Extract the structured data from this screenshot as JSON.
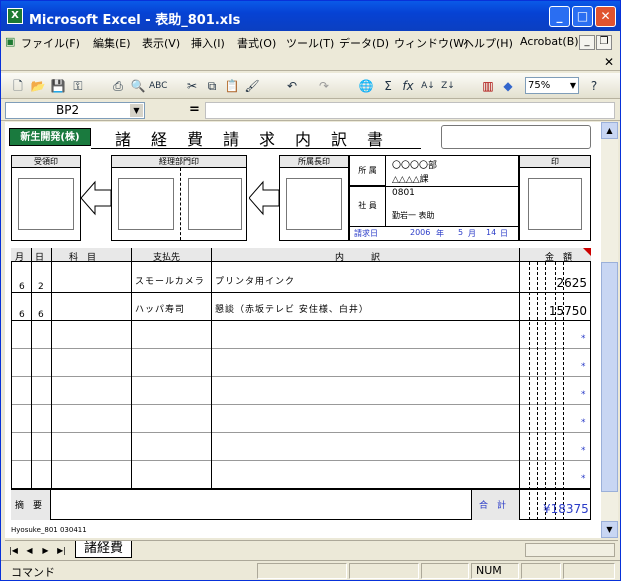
{
  "window": {
    "title": "Microsoft Excel - 表助_801.xls",
    "title_icon": "X"
  },
  "menu": [
    "ファイル(F)",
    "編集(E)",
    "表示(V)",
    "挿入(I)",
    "書式(O)",
    "ツール(T)",
    "データ(D)",
    "ウィンドウ(W)",
    "ヘルプ(H)",
    "Acrobat(B)"
  ],
  "toolbar": {
    "zoom": "75%"
  },
  "formula": {
    "namebox": "BP2",
    "eq": "="
  },
  "form": {
    "company": "新生開発(株)",
    "title": "諸　経　費　請　求　内　訳　書",
    "stamps": {
      "receipt": "受領印",
      "accounting": "経理部門印",
      "dept_head": "所属長印",
      "seal": "印"
    },
    "dept_label": "所 属",
    "dept1": "〇〇〇〇部",
    "dept2": "△△△△課",
    "emp_label": "社 員",
    "emp_no": "0801",
    "emp_name": "勤岩一 表助",
    "date_label": "請求日",
    "year": "2006",
    "year_unit": "年",
    "month": "5",
    "month_unit": "月",
    "day": "14",
    "day_unit": "日",
    "headers": {
      "month": "月",
      "day": "日",
      "subject": "科　目",
      "payee": "支払先",
      "detail": "内　　　訳",
      "amount": "金　額"
    },
    "rows": [
      {
        "month": "6",
        "day": "2",
        "payee": "スモールカメラ",
        "detail": "プリンタ用インク",
        "amount": "2625"
      },
      {
        "month": "6",
        "day": "6",
        "payee": "ハッパ寿司",
        "detail": "懇談（赤坂テレビ 安住様、白井）",
        "amount": "15750"
      }
    ],
    "empty_mark": "*",
    "remarks_label": "摘　要",
    "total_label": "合　計",
    "total": "¥18375",
    "footer_code": "Hyosuke_801 030411"
  },
  "sheet_tab": "諸経費",
  "status": {
    "text": "コマンド",
    "num": "NUM"
  }
}
